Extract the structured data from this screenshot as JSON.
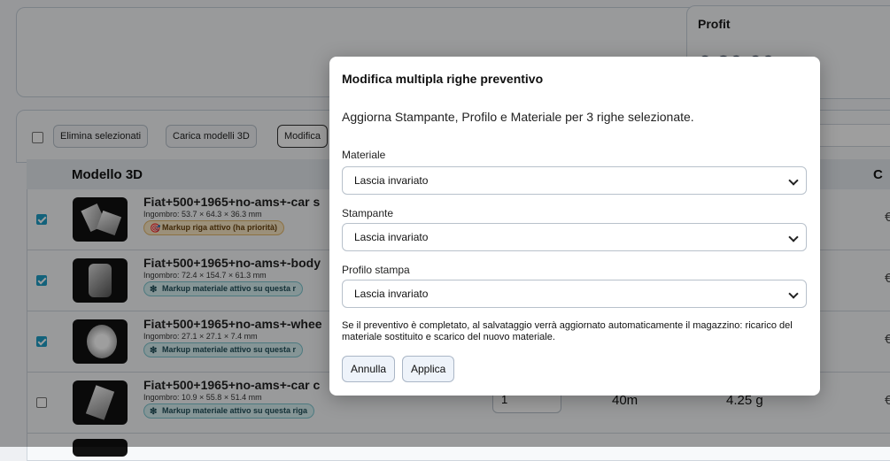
{
  "profit": {
    "label": "Profit",
    "value": "€ 20,00"
  },
  "toolbar": {
    "delete_selected": "Elimina selezionati",
    "load_models": "Carica modelli 3D",
    "bulk_edit": "Modifica"
  },
  "table": {
    "col_model": "Modello 3D",
    "col_right": "C",
    "rows": [
      {
        "name": "Fiat+500+1965+no-ams+-car s",
        "dim": "Ingombro: 53.7 × 64.3 × 36.3 mm",
        "badge": "Markup riga attivo (ha priorità)",
        "badge_icon": "🎯",
        "checked": true,
        "euro": "€"
      },
      {
        "name": "Fiat+500+1965+no-ams+-body",
        "dim": "Ingombro: 72.4 × 154.7 × 61.3 mm",
        "badge": "Markup materiale attivo su questa r",
        "badge_icon": "❇",
        "checked": true,
        "euro": "€"
      },
      {
        "name": "Fiat+500+1965+no-ams+-whee",
        "dim": "Ingombro: 27.1 × 27.1 × 7.4 mm",
        "badge": "Markup materiale attivo su questa r",
        "badge_icon": "❇",
        "checked": true,
        "euro": "€"
      },
      {
        "name": "Fiat+500+1965+no-ams+-car c",
        "dim": "Ingombro: 10.9 × 55.8 × 51.4 mm",
        "badge": "Markup materiale attivo su questa riga",
        "badge_icon": "❇",
        "checked": false,
        "qty": "1",
        "time": "40m",
        "weight": "4.25 g",
        "euro": "€"
      }
    ]
  },
  "modal": {
    "title": "Modifica multipla righe preventivo",
    "subtitle": "Aggiorna Stampante, Profilo e Materiale per 3 righe selezionate.",
    "material_label": "Materiale",
    "material_value": "Lascia invariato",
    "printer_label": "Stampante",
    "printer_value": "Lascia invariato",
    "profile_label": "Profilo stampa",
    "profile_value": "Lascia invariato",
    "note": "Se il preventivo è completato, al salvataggio verrà aggiornato automaticamente il magazzino: ricarico del materiale sostituito e scarico del nuovo materiale.",
    "cancel": "Annulla",
    "apply": "Applica"
  }
}
